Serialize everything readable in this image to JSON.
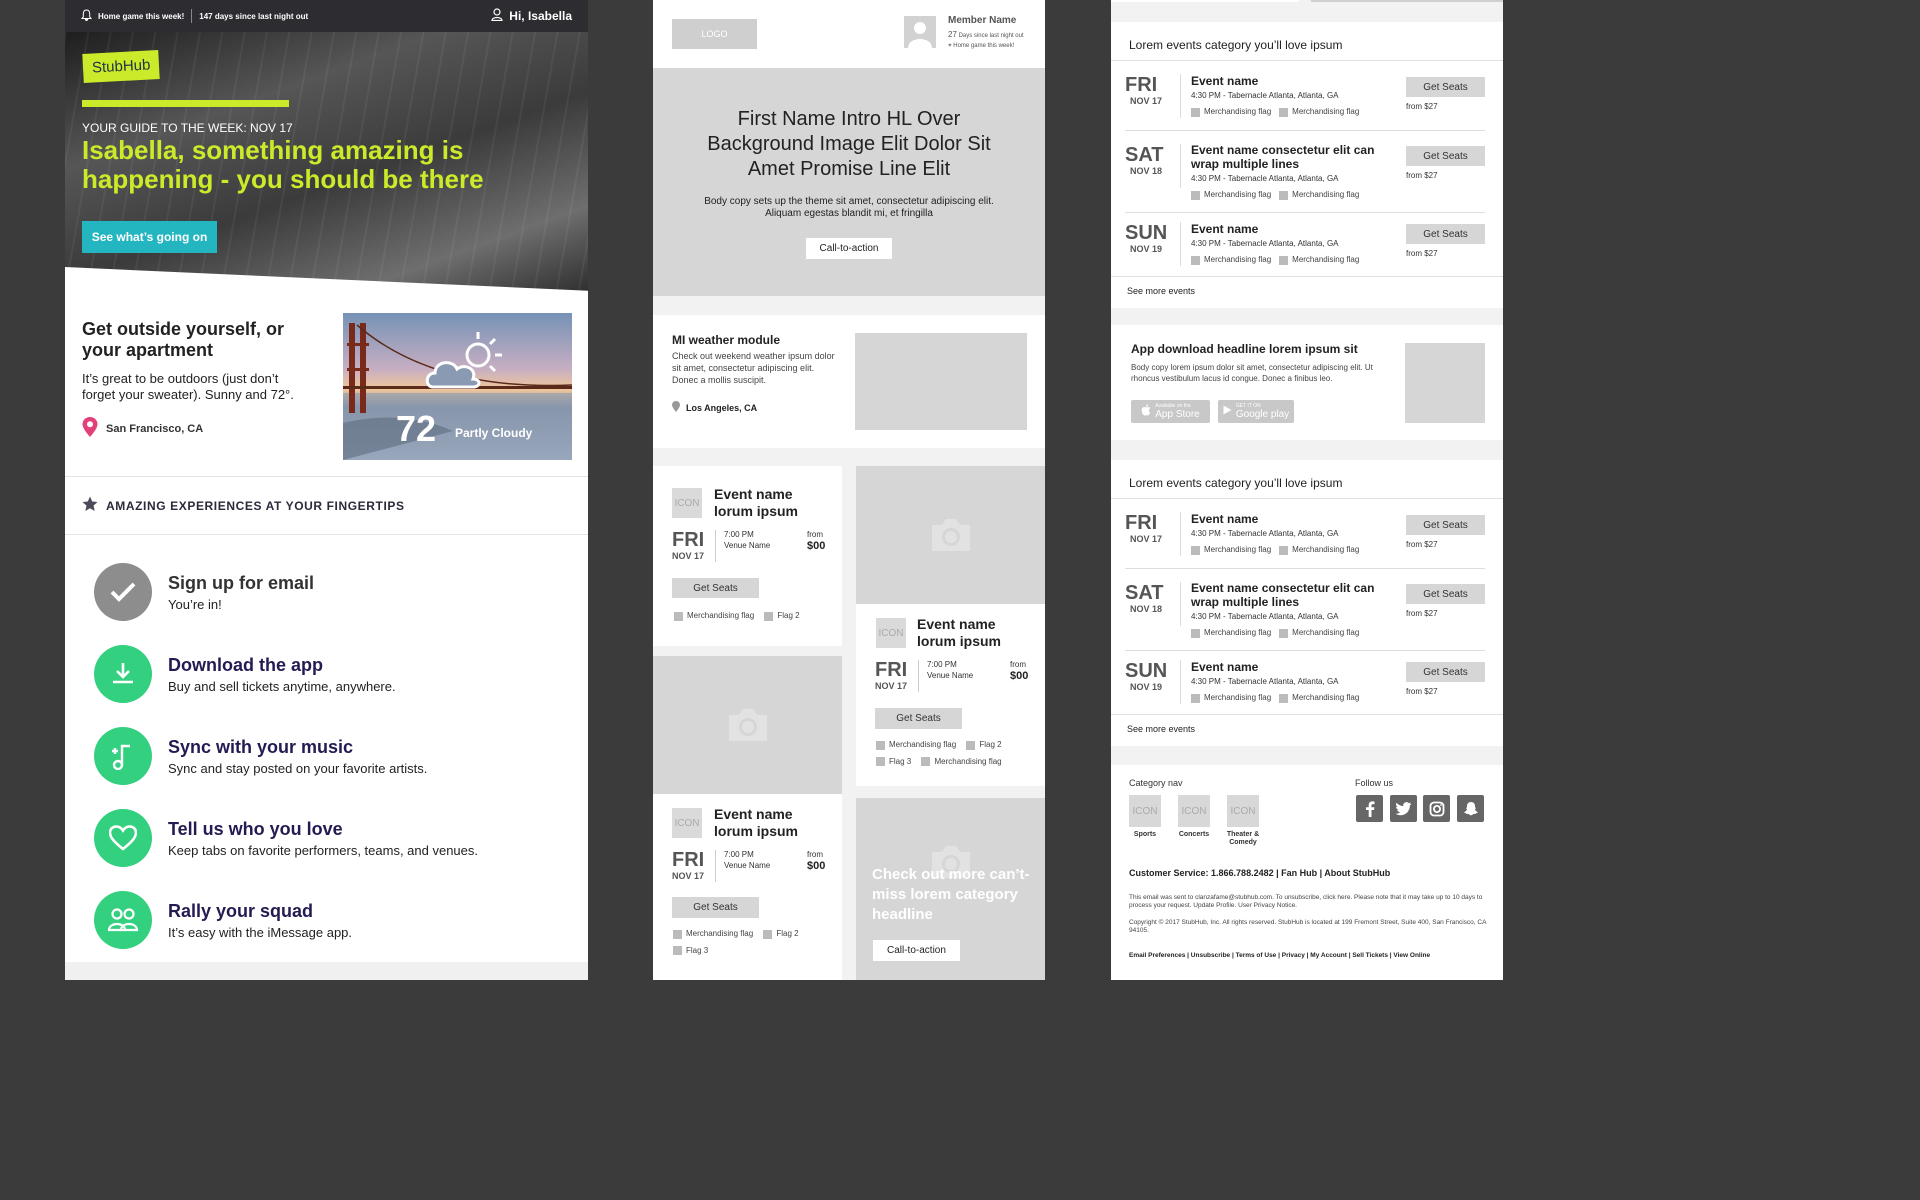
{
  "panel1": {
    "topbar": {
      "home_game": "Home game this week!",
      "days": "147 days since last night out",
      "greeting": "Hi, Isabella"
    },
    "hero": {
      "logo": "StubHub",
      "kicker": "YOUR GUIDE TO THE WEEK: NOV 17",
      "title": "Isabella, something amazing is happening - you should be there",
      "cta": "See what’s going on"
    },
    "outside": {
      "title": "Get outside yourself, or your apartment",
      "body": "It’s great to be outdoors (just don’t forget your sweater). Sunny and 72°.",
      "location": "San Francisco, CA",
      "temp": "72",
      "condition": "Partly Cloudy"
    },
    "amazing_heading": "AMAZING EXPERIENCES AT YOUR FINGERTIPS",
    "experiences": [
      {
        "title": "Sign up for email",
        "sub": "You’re in!"
      },
      {
        "title": "Download the app",
        "sub": "Buy and sell tickets anytime, anywhere."
      },
      {
        "title": "Sync with your music",
        "sub": "Sync and stay posted on your favorite artists."
      },
      {
        "title": "Tell us who you love",
        "sub": "Keep tabs on favorite performers, teams, and venues."
      },
      {
        "title": "Rally your squad",
        "sub": "It’s easy with the iMessage app."
      }
    ],
    "colors": {
      "lime": "#cbeb2a",
      "teal": "#23b5c0",
      "green": "#33d07f",
      "navy": "#231b52",
      "pin": "#e2407a"
    }
  },
  "panel2": {
    "header": {
      "logo": "LOGO",
      "member_name": "Member Name",
      "days_num": "27",
      "days_text": "Days since last night out",
      "home_game": "Home game this week!"
    },
    "hero": {
      "title": "First Name Intro HL Over Background Image Elit Dolor Sit Amet Promise Line Elit",
      "body": "Body copy sets up the theme sit amet, consectetur adipiscing elit. Aliquam egestas blandit mi, et fringilla",
      "cta": "Call-to-action"
    },
    "weather": {
      "title": "MI weather module",
      "body": "Check out weekend weather ipsum dolor sit amet, consectetur adipiscing elit. Donec a mollis suscipit.",
      "location": "Los Angeles, CA"
    },
    "card_common": {
      "icon": "ICON",
      "name": "Event name lorum ipsum",
      "day": "FRI",
      "date": "NOV 17",
      "time": "7:00 PM",
      "venue": "Venue Name",
      "from": "from",
      "price": "$00",
      "button": "Get Seats"
    },
    "card1_flags": [
      "Merchandising flag",
      "Flag 2"
    ],
    "card2_flags_row1": [
      "Merchandising flag",
      "Flag 2"
    ],
    "card2_flags_row2": [
      "Flag 3",
      "Merchandising flag"
    ],
    "card3_flags_row1": [
      "Merchandising flag",
      "Flag 2"
    ],
    "card3_flags_row2": [
      "Flag 3"
    ],
    "promo": {
      "title": "Check out more can’t-miss lorem category headline",
      "cta": "Call-to-action"
    }
  },
  "panel3": {
    "section_title": "Lorem events category you’ll love ipsum",
    "events": [
      {
        "day": "FRI",
        "date": "NOV 17",
        "name": "Event name"
      },
      {
        "day": "SAT",
        "date": "NOV 18",
        "name": "Event name consectetur elit can wrap multiple lines"
      },
      {
        "day": "SUN",
        "date": "NOV 19",
        "name": "Event name"
      }
    ],
    "event_meta": "4:30 PM - Tabernacle Atlanta, Atlanta, GA",
    "flag": "Merchandising flag",
    "get_seats": "Get Seats",
    "price": "from $27",
    "see_more": "See more events",
    "app": {
      "title": "App download headline lorem ipsum sit",
      "body": "Body copy lorem ipsum dolor sit amet, consectetur adipiscing elit. Ut rhoncus vestibulum lacus id congue. Donec a finibus leo.",
      "appstore_small": "Available on the",
      "appstore": "App Store",
      "google_small": "GET IT ON",
      "google": "Google play"
    },
    "footer": {
      "category_nav": "Category nav",
      "follow_us": "Follow us",
      "icon": "ICON",
      "categories": [
        "Sports",
        "Concerts",
        "Theater & Comedy"
      ],
      "customer_service": "Customer Service: 1.866.788.2482 | Fan Hub | About StubHub",
      "legal1": "This email was sent to clanzafame@stubhub.com. To unsubscribe, click here. Please note that it may take up to 10 days to process your request. Update Profile. User Privacy Notice.",
      "legal2": "Copyright © 2017 StubHub, Inc. All rights reserved. StubHub is located at 199 Fremont Street, Suite 400, San Francisco, CA 94105.",
      "links": "Email Preferences | Unsubscribe | Terms of Use | Privacy | My Account | Sell Tickets | View Online"
    }
  }
}
